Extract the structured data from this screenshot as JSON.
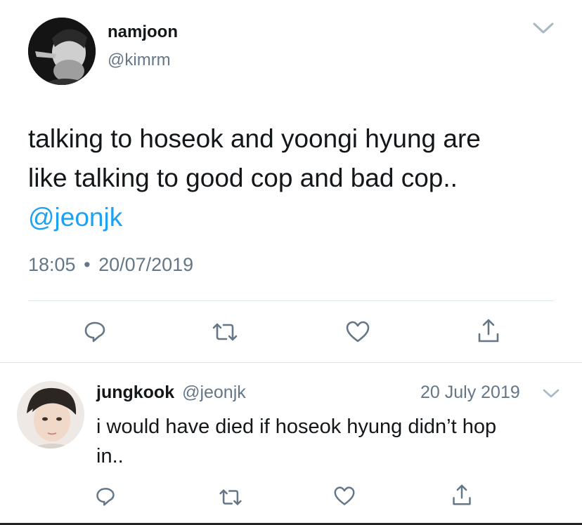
{
  "main_tweet": {
    "display_name": "namjoon",
    "handle": "@kimrm",
    "text_line1": "talking to hoseok and yoongi hyung are",
    "text_line2": "like talking to good cop and bad cop..",
    "mention": "@jeonjk",
    "time": "18:05",
    "separator": "•",
    "date": "20/07/2019",
    "avatar_icon": "profile-photo-bw",
    "more_icon": "chevron-down-icon"
  },
  "reply": {
    "display_name": "jungkook",
    "handle": "@jeonjk",
    "date": "20 July 2019",
    "text_line1": "i would have died if hoseok hyung didn’t hop",
    "text_line2": "in..",
    "avatar_icon": "profile-photo-color",
    "more_icon": "chevron-down-icon"
  },
  "actions": [
    "reply-icon",
    "retweet-icon",
    "like-icon",
    "share-icon"
  ],
  "colors": {
    "text": "#14171a",
    "secondary": "#657786",
    "link": "#1da1f2",
    "divider": "#e1e8ed",
    "icon": "#657786"
  }
}
